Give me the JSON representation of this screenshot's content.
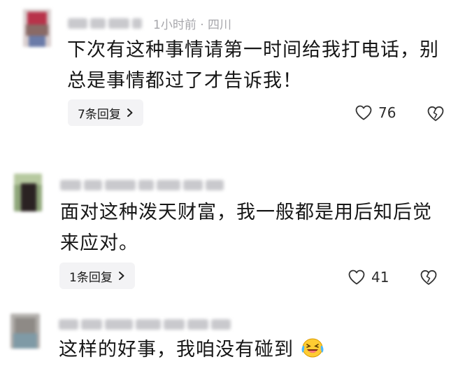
{
  "comments": [
    {
      "time": "1小时前 · 四川",
      "text_line1": "下次有这种事情请第一时间给我打电话，别",
      "text_line2": "总是事情都过了才告诉我！",
      "reply_label": "7条回复",
      "likes": "76"
    },
    {
      "text_line1": "面对这种泼天财富，我一般都是用后知后觉",
      "text_line2": "来应对。",
      "reply_label": "1条回复",
      "likes": "41"
    },
    {
      "text_line1": "这样的好事，我咱没有碰到"
    }
  ],
  "icons": {
    "like": "heart-outline-icon",
    "dislike": "broken-heart-icon",
    "chevron": "chevron-right-icon",
    "emoji": "laughing-crying-emoji"
  }
}
